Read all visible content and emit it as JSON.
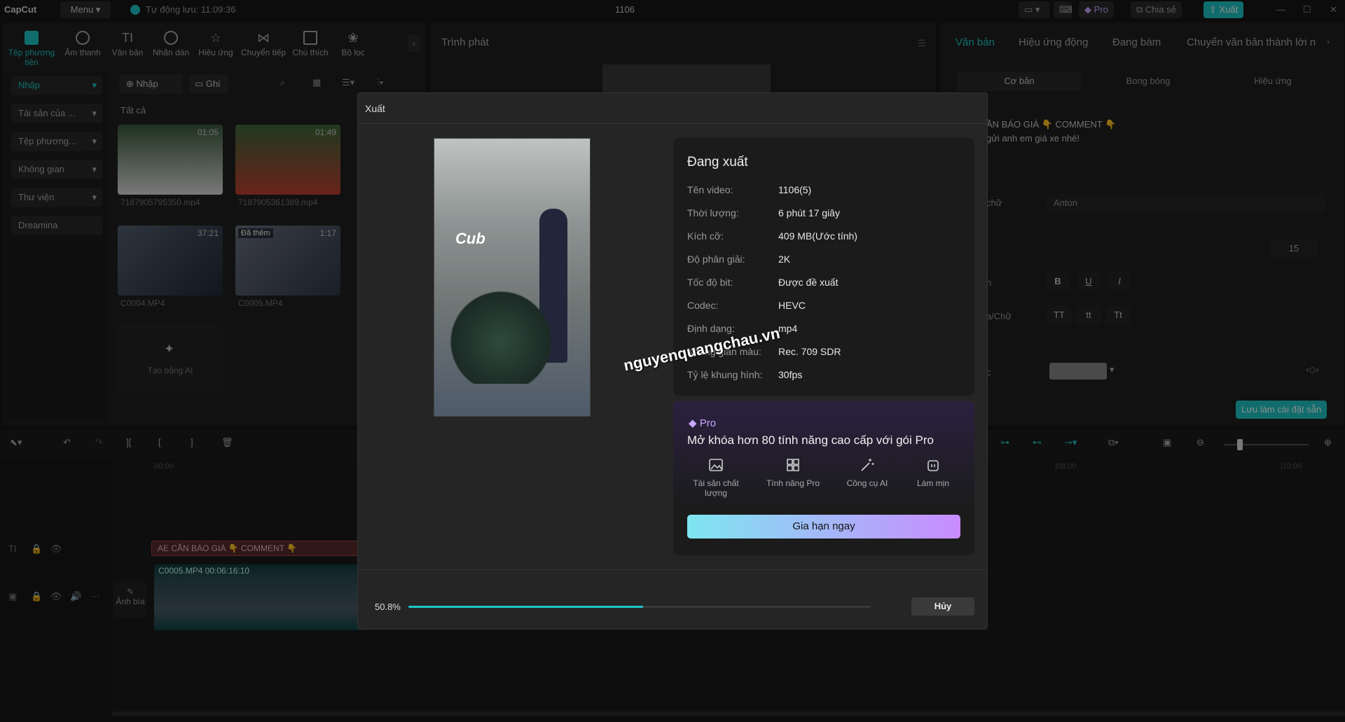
{
  "titlebar": {
    "app_name": "CapCut",
    "menu_label": "Menu",
    "autosave": "Tự động lưu: 11:09:36",
    "project_title": "1106",
    "pro_label": "Pro",
    "share_label": "Chia sẻ",
    "export_label": "Xuất"
  },
  "toolbar": {
    "items": [
      "Tệp phương tiện",
      "Âm thanh",
      "Văn bản",
      "Nhãn dán",
      "Hiệu ứng",
      "Chuyển tiếp",
      "Chú thích",
      "Bộ lọc"
    ]
  },
  "sidebar": {
    "items": [
      "Nhập",
      "Tài sản của ...",
      "Tệp phương...",
      "Không gian",
      "Thư viện",
      "Dreamina"
    ]
  },
  "media": {
    "import_label": "Nhập",
    "record_label": "Ghi",
    "all_label": "Tất cả",
    "ai_create_label": "Tạo bằng AI",
    "thumbs": [
      {
        "dur": "01:05",
        "name": "7187905795350.mp4"
      },
      {
        "dur": "01:49",
        "name": "7187905361389.mp4"
      },
      {
        "dur": "37:21",
        "name": "C0004.MP4"
      },
      {
        "dur": "1:17",
        "name": "C0005.MP4",
        "badge": "Đã thêm"
      }
    ]
  },
  "player": {
    "title": "Trình phát"
  },
  "right_panel": {
    "tabs": [
      "Văn bản",
      "Hiệu ứng động",
      "Đang bám",
      "Chuyển văn bản thành lời n"
    ],
    "subtabs": [
      "Cơ bản",
      "Bong bóng",
      "Hiệu ứng"
    ],
    "text_preview_1": "ẦN BÁO GIÁ 👇 COMMENT 👇",
    "text_preview_2": "gửi anh em giá xe nhé!",
    "font_label": "chữ",
    "font_value": "Anton",
    "size_value": "15",
    "style_label": "n",
    "case_label": "a/Chữ",
    "case_opts": [
      "TT",
      "tt",
      "Tt"
    ],
    "color_label": "c",
    "save_preset": "Lưu làm cài đặt sẵn"
  },
  "timeline": {
    "time_start": "00:00",
    "time_mid": "|08:00",
    "time_end": "|10:00",
    "text_clip": "AE CẦN BÁO GIÁ 👇 COMMENT 👇",
    "video_clip": "C0005.MP4  00:06:16:10",
    "cover_label": "Ảnh bìa"
  },
  "export_dialog": {
    "title": "Xuất",
    "status": "Đang xuất",
    "rows": [
      {
        "k": "Tên video:",
        "v": "1106(5)"
      },
      {
        "k": "Thời lượng:",
        "v": "6 phút 17 giây"
      },
      {
        "k": "Kích cỡ:",
        "v": "409 MB(Ước tính)"
      },
      {
        "k": "Độ phân giải:",
        "v": "2K"
      },
      {
        "k": "Tốc độ bit:",
        "v": "Được đề xuất"
      },
      {
        "k": "Codec:",
        "v": "HEVC"
      },
      {
        "k": "Định dạng:",
        "v": "mp4"
      },
      {
        "k": "Không gian màu:",
        "v": "Rec. 709 SDR"
      },
      {
        "k": "Tỷ lệ khung hình:",
        "v": "30fps"
      }
    ],
    "pro_label": "Pro",
    "pro_headline": "Mở khóa hơn 80 tính năng cao cấp với gói Pro",
    "features": [
      "Tài sản chất lượng",
      "Tính năng Pro",
      "Công cụ AI",
      "Làm mịn"
    ],
    "renew_label": "Gia hạn ngay",
    "progress_text": "50.8%",
    "progress": 0.508,
    "cancel_label": "Hủy"
  },
  "watermark": "nguyenquangchau.vn",
  "colors": {
    "accent": "#1fc6c6",
    "pro_gradient_start": "#7ee6f0",
    "pro_gradient_end": "#c98bff",
    "progress": "#1fc6c6"
  }
}
